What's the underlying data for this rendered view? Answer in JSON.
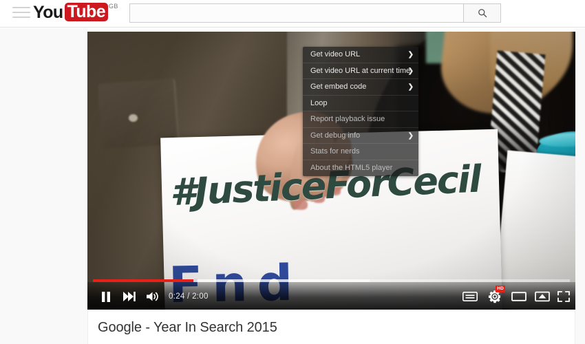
{
  "masthead": {
    "guide_toggle_name": "Guide",
    "logo": {
      "text_primary": "You",
      "text_accent": "Tube",
      "country": "GB",
      "accent_color": "#cc181e"
    },
    "search": {
      "value": "",
      "placeholder": "",
      "button_icon": "search-icon"
    }
  },
  "player": {
    "state": "playing",
    "time_display": "0:24 / 2:00",
    "current_time": "0:24",
    "duration": "2:00",
    "progress_played_percent": 21,
    "progress_loaded_percent": 58,
    "quality_badge": "HD",
    "progress_color": "#e62117",
    "controls": {
      "pause_label": "Pause",
      "next_label": "Next video",
      "volume_label": "Mute",
      "subtitles_label": "Subtitles/closed captions",
      "settings_label": "Settings",
      "theater_label": "Theater mode",
      "cast_label": "Play on TV",
      "fullscreen_label": "Full screen"
    },
    "scene": {
      "sign_text_line1": "#JusticeForCecil",
      "sign_text_line2": "Fnd",
      "sign_text_color": "#2e4a41",
      "sign_text2_color": "#2f4a9a"
    }
  },
  "context_menu": {
    "items": [
      {
        "label": "Get video URL",
        "has_submenu": true,
        "dim": false
      },
      {
        "label": "Get video URL at current time",
        "has_submenu": true,
        "dim": false
      },
      {
        "label": "Get embed code",
        "has_submenu": true,
        "dim": false
      },
      {
        "label": "Loop",
        "has_submenu": false,
        "dim": false
      },
      {
        "label": "Report playback issue",
        "has_submenu": false,
        "dim": true
      },
      {
        "label": "Get debug info",
        "has_submenu": true,
        "dim": true
      },
      {
        "label": "Stats for nerds",
        "has_submenu": false,
        "dim": true
      },
      {
        "label": "About the HTML5 player",
        "has_submenu": false,
        "dim": true
      }
    ],
    "submenu_arrow": "❯"
  },
  "watch_info": {
    "title": "Google - Year In Search 2015"
  }
}
